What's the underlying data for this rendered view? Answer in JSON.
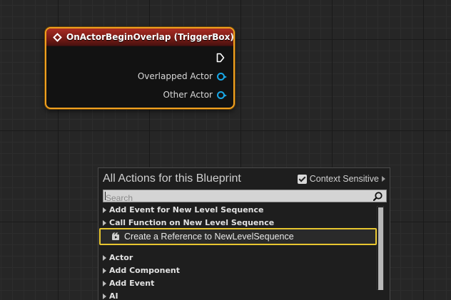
{
  "node": {
    "title": "OnActorBeginOverlap (TriggerBox)",
    "pins": [
      "Overlapped Actor",
      "Other Actor"
    ]
  },
  "menu": {
    "title": "All Actions for this Blueprint",
    "context_label": "Context Sensitive",
    "context_checked": true,
    "search_placeholder": "Search",
    "items": [
      {
        "label": "Add Event for New Level Sequence",
        "expandable": true
      },
      {
        "label": "Call Function on New Level Sequence",
        "expandable": true
      },
      {
        "label": "Create a Reference to NewLevelSequence",
        "selected": true
      },
      {
        "label": "Actor",
        "expandable": true
      },
      {
        "label": "Add Component",
        "expandable": true
      },
      {
        "label": "Add Event",
        "expandable": true
      },
      {
        "label": "AI",
        "expandable": true
      }
    ]
  },
  "colors": {
    "node_border": "#f0a020",
    "node_header": "#a82c24",
    "object_pin": "#19a8e8",
    "selection": "#e8c630"
  },
  "icons": {
    "event": "event-diamond-icon",
    "exec": "exec-pin-icon",
    "search": "magnifier-icon",
    "reference": "level-sequence-icon"
  }
}
